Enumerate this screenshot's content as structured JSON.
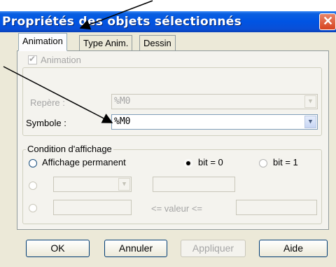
{
  "window": {
    "title": "Propriétés des objets sélectionnés",
    "close_glyph": "✕"
  },
  "tabs": [
    {
      "label": "Animation",
      "active": true
    },
    {
      "label": "Type Anim.",
      "active": false
    },
    {
      "label": "Dessin",
      "active": false
    }
  ],
  "animation": {
    "checkbox_label": "Animation",
    "checked": true,
    "repere_label": "Repère :",
    "repere_value": "%M0",
    "symbole_label": "Symbole :",
    "symbole_value": "%M0"
  },
  "condition": {
    "group_title": "Condition d'affichage",
    "options": [
      {
        "label": "Affichage permanent",
        "selected": false
      },
      {
        "label": "bit = 0",
        "selected": true
      },
      {
        "label": "bit = 1",
        "selected": false
      }
    ],
    "compare_label": "<= valeur <="
  },
  "buttons": {
    "ok": "OK",
    "cancel": "Annuler",
    "apply": "Appliquer",
    "help": "Aide"
  },
  "icons": {
    "close": "close-icon",
    "dropdown": "chevron-down-icon",
    "check": "checkmark-icon"
  }
}
